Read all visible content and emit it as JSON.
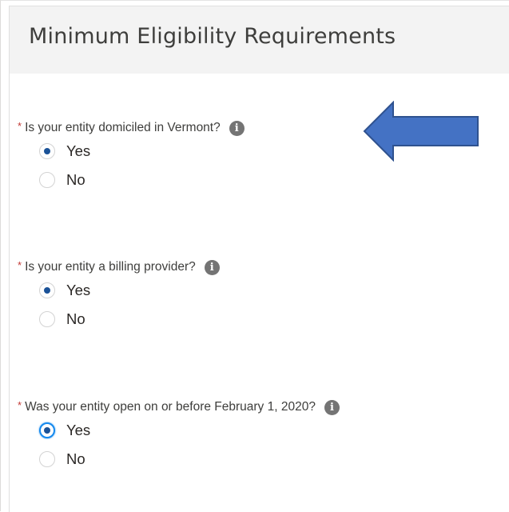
{
  "card": {
    "title": "Minimum Eligibility Requirements"
  },
  "questions": [
    {
      "required_marker": "*",
      "label": "Is your entity domiciled in Vermont?",
      "info_icon": "info-icon",
      "options": [
        {
          "label": "Yes",
          "selected": true
        },
        {
          "label": "No",
          "selected": false
        }
      ]
    },
    {
      "required_marker": "*",
      "label": "Is your entity a billing provider?",
      "info_icon": "info-icon",
      "options": [
        {
          "label": "Yes",
          "selected": true
        },
        {
          "label": "No",
          "selected": false
        }
      ]
    },
    {
      "required_marker": "*",
      "label": "Was your entity open on or before February 1, 2020?",
      "info_icon": "info-icon",
      "options": [
        {
          "label": "Yes",
          "selected": true,
          "focused": true
        },
        {
          "label": "No",
          "selected": false
        }
      ]
    }
  ],
  "annotation": {
    "icon": "left-arrow-icon",
    "color": "#4472c4",
    "border_color": "#2f528f"
  },
  "colors": {
    "required": "#c23934",
    "radio_selected": "#1b5297",
    "focus_ring": "#1589ee",
    "header_bg": "#f3f3f3"
  }
}
